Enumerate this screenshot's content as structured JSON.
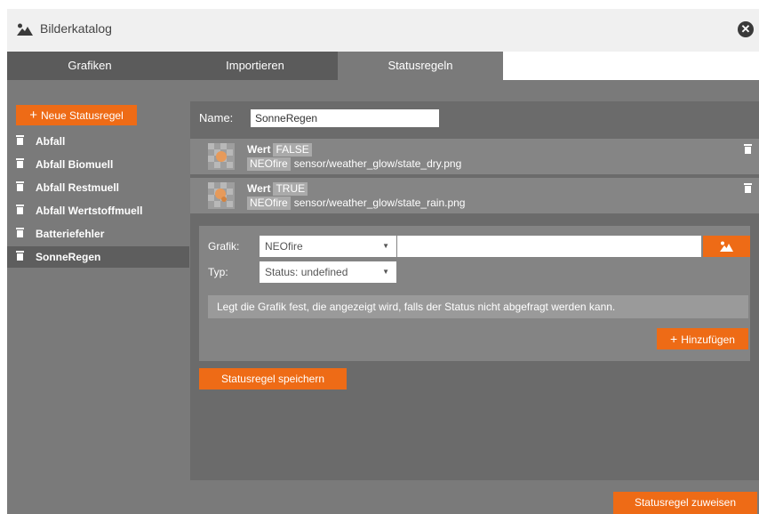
{
  "window": {
    "title": "Bilderkatalog",
    "close_glyph": "✕",
    "icon": "image-icon"
  },
  "tabs": [
    {
      "label": "Grafiken"
    },
    {
      "label": "Importieren"
    },
    {
      "label": "Statusregeln",
      "active": true
    }
  ],
  "sidebar": {
    "new_rule_label": "Neue Statusregel",
    "items": [
      {
        "label": "Abfall"
      },
      {
        "label": "Abfall Biomuell"
      },
      {
        "label": "Abfall Restmuell"
      },
      {
        "label": "Abfall Wertstoffmuell"
      },
      {
        "label": "Batteriefehler"
      },
      {
        "label": "SonneRegen",
        "selected": true
      }
    ]
  },
  "editor": {
    "name_label": "Name:",
    "name_value": "SonneRegen",
    "status_rows": [
      {
        "wert_label": "Wert",
        "wert_value": "FALSE",
        "source": "NEOfire",
        "path": "sensor/weather_glow/state_dry.png"
      },
      {
        "wert_label": "Wert",
        "wert_value": "TRUE",
        "source": "NEOfire",
        "path": "sensor/weather_glow/state_rain.png"
      }
    ],
    "form": {
      "grafik_label": "Grafik:",
      "grafik_value": "NEOfire",
      "typ_label": "Typ:",
      "typ_value": "Status: undefined",
      "hint": "Legt die Grafik fest, die angezeigt wird, falls der Status nicht abgefragt werden kann.",
      "add_label": "Hinzufügen"
    },
    "save_label": "Statusregel speichern"
  },
  "assign_label": "Statusregel zuweisen",
  "colors": {
    "accent": "#ee6b16",
    "panel": "#7a7a7a",
    "tab_inactive": "#5b5b5b"
  }
}
